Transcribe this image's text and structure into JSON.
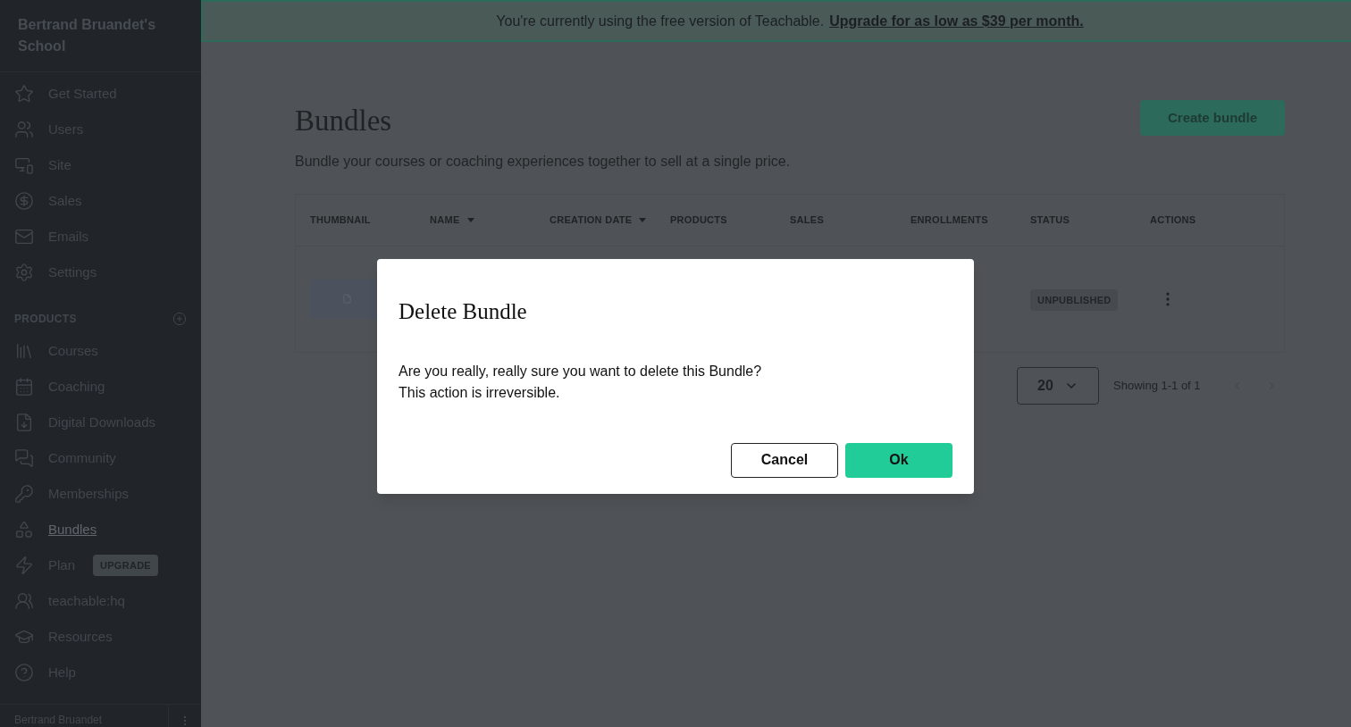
{
  "sidebar": {
    "school_name": "Bertrand Bruandet's School",
    "items": [
      {
        "label": "Get Started",
        "selected": false
      },
      {
        "label": "Users",
        "selected": false
      },
      {
        "label": "Site",
        "selected": false
      },
      {
        "label": "Sales",
        "selected": false
      },
      {
        "label": "Emails",
        "selected": false
      },
      {
        "label": "Settings",
        "selected": false
      }
    ],
    "products_heading": "PRODUCTS",
    "product_items": [
      {
        "label": "Courses",
        "selected": false
      },
      {
        "label": "Coaching",
        "selected": false
      },
      {
        "label": "Digital Downloads",
        "selected": false
      },
      {
        "label": "Community",
        "selected": false
      },
      {
        "label": "Memberships",
        "selected": false
      },
      {
        "label": "Bundles",
        "selected": true
      },
      {
        "label": "Plan",
        "selected": false,
        "badge": "UPGRADE"
      },
      {
        "label": "teachable:hq",
        "selected": false
      },
      {
        "label": "Resources",
        "selected": false
      },
      {
        "label": "Help",
        "selected": false
      }
    ],
    "user_name": "Bertrand Bruandet"
  },
  "banner": {
    "text": "You're currently using the free version of Teachable.",
    "link": "Upgrade for as low as $39 per month."
  },
  "page": {
    "title": "Bundles",
    "subtitle": "Bundle your courses or coaching experiences together to sell at a single price.",
    "create_button": "Create bundle"
  },
  "table": {
    "columns": [
      {
        "label": "THUMBNAIL",
        "sortable": false
      },
      {
        "label": "NAME",
        "sortable": true
      },
      {
        "label": "CREATION DATE",
        "sortable": true
      },
      {
        "label": "PRODUCTS",
        "sortable": false
      },
      {
        "label": "SALES",
        "sortable": false
      },
      {
        "label": "ENROLLMENTS",
        "sortable": false
      },
      {
        "label": "STATUS",
        "sortable": false
      },
      {
        "label": "ACTIONS",
        "sortable": false
      }
    ],
    "rows": [
      {
        "status": "UNPUBLISHED"
      }
    ]
  },
  "pagination": {
    "page_size": "20",
    "showing": "Showing 1-1 of 1"
  },
  "dialog": {
    "title": "Delete Bundle",
    "message_lines": [
      "Are you really, really sure you want to delete this Bundle?",
      "This action is irreversible."
    ],
    "cancel": "Cancel",
    "ok": "Ok"
  }
}
